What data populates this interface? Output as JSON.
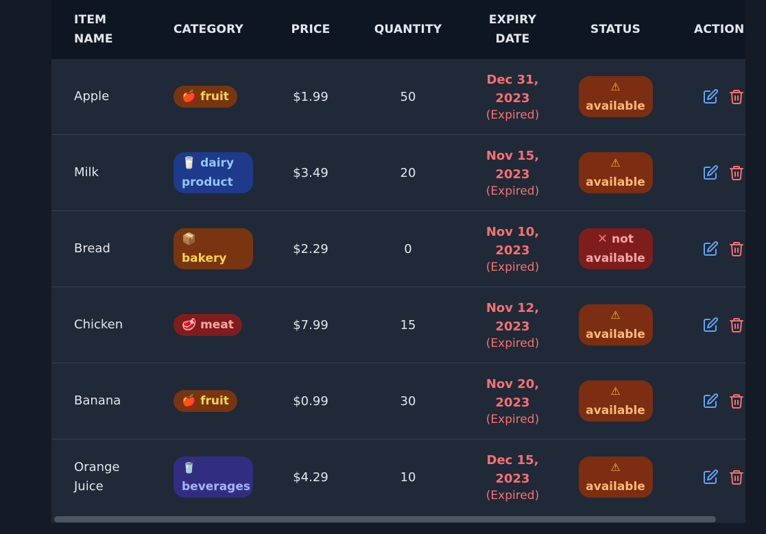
{
  "table": {
    "headers": {
      "item_name": "ITEM\nNAME",
      "category": "CATEGORY",
      "price": "PRICE",
      "quantity": "QUANTITY",
      "expiry_date": "EXPIRY\nDATE",
      "status": "STATUS",
      "action": "ACTION"
    },
    "rows": [
      {
        "name": "Apple",
        "category_icon": "🍎",
        "category": "fruit",
        "price": "$1.99",
        "quantity": "50",
        "expiry": "Dec 31,\n2023",
        "expired_label": "(Expired)",
        "status_icon": "⚠",
        "status": "available"
      },
      {
        "name": "Milk",
        "category_icon": "🥛",
        "category": "dairy product",
        "price": "$3.49",
        "quantity": "20",
        "expiry": "Nov 15,\n2023",
        "expired_label": "(Expired)",
        "status_icon": "⚠",
        "status": "available"
      },
      {
        "name": "Bread",
        "category_icon": "📦",
        "category": "bakery",
        "price": "$2.29",
        "quantity": "0",
        "expiry": "Nov 10,\n2023",
        "expired_label": "(Expired)",
        "status_icon": "✕",
        "status": "not available"
      },
      {
        "name": "Chicken",
        "category_icon": "🥩",
        "category": "meat",
        "price": "$7.99",
        "quantity": "15",
        "expiry": "Nov 12,\n2023",
        "expired_label": "(Expired)",
        "status_icon": "⚠",
        "status": "available"
      },
      {
        "name": "Banana",
        "category_icon": "🍎",
        "category": "fruit",
        "price": "$0.99",
        "quantity": "30",
        "expiry": "Nov 20,\n2023",
        "expired_label": "(Expired)",
        "status_icon": "⚠",
        "status": "available"
      },
      {
        "name": "Orange\nJuice",
        "category_icon": "🥤",
        "category": "beverages",
        "price": "$4.29",
        "quantity": "10",
        "expiry": "Dec 15,\n2023",
        "expired_label": "(Expired)",
        "status_icon": "⚠",
        "status": "available"
      }
    ]
  },
  "colors": {
    "page_bg": "#141a26",
    "header_bg": "#0f1623",
    "row_bg": "#1f2937",
    "expired_red": "#f87171",
    "edit_blue": "#60a5fa",
    "delete_red": "#f87171"
  },
  "icons": {
    "edit": "edit-icon",
    "delete": "trash-icon",
    "warning": "warning-icon",
    "not_available": "x-icon"
  }
}
